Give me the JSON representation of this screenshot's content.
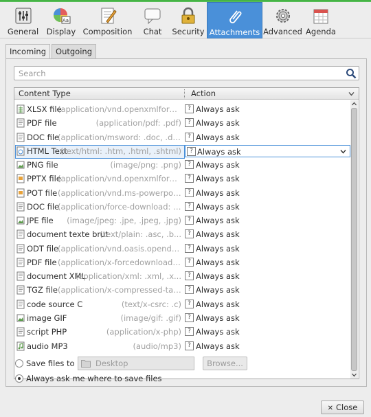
{
  "toolbar": {
    "items": [
      {
        "label": "General",
        "icon": "general-sliders-icon",
        "active": false
      },
      {
        "label": "Display",
        "icon": "display-palette-icon",
        "active": false
      },
      {
        "label": "Composition",
        "icon": "composition-pencil-icon",
        "active": false
      },
      {
        "label": "Chat",
        "icon": "chat-bubble-icon",
        "active": false
      },
      {
        "label": "Security",
        "icon": "security-lock-icon",
        "active": false
      },
      {
        "label": "Attachments",
        "icon": "attachments-paperclip-icon",
        "active": true
      },
      {
        "label": "Advanced",
        "icon": "advanced-gear-icon",
        "active": false
      },
      {
        "label": "Agenda",
        "icon": "agenda-calendar-icon",
        "active": false
      }
    ],
    "accent_color": "#4a90d9"
  },
  "tabs": [
    {
      "label": "Incoming",
      "active": true
    },
    {
      "label": "Outgoing",
      "active": false
    }
  ],
  "search": {
    "placeholder": "Search"
  },
  "table": {
    "columns": [
      "Content Type",
      "Action"
    ],
    "rows": [
      {
        "name": "XLSX file",
        "mime": "(application/vnd.openxmlforma...",
        "action": "Always ask",
        "icon": "spreadsheet-file-icon"
      },
      {
        "name": "PDF file",
        "mime": "(application/pdf: .pdf)",
        "action": "Always ask",
        "icon": "document-file-icon"
      },
      {
        "name": "DOC file",
        "mime": "(application/msword: .doc, .dot)",
        "action": "Always ask",
        "icon": "document-file-icon"
      },
      {
        "name": "HTML Text",
        "mime": "(text/html: .htm, .html, .shtml)",
        "action": "Always ask",
        "icon": "html-file-icon",
        "selected": true
      },
      {
        "name": "PNG file",
        "mime": "(image/png: .png)",
        "action": "Always ask",
        "icon": "image-file-icon"
      },
      {
        "name": "PPTX file",
        "mime": "(application/vnd.openxmlforma...",
        "action": "Always ask",
        "icon": "presentation-file-icon"
      },
      {
        "name": "POT file",
        "mime": "(application/vnd.ms-powerpoint:...",
        "action": "Always ask",
        "icon": "presentation-file-icon"
      },
      {
        "name": "DOC file",
        "mime": "(application/force-download: .do...",
        "action": "Always ask",
        "icon": "document-file-icon"
      },
      {
        "name": "JPE file",
        "mime": "(image/jpeg: .jpe, .jpeg, .jpg)",
        "action": "Always ask",
        "icon": "image-file-icon"
      },
      {
        "name": "document texte brut",
        "mime": "(text/plain: .asc, .b...",
        "action": "Always ask",
        "icon": "document-file-icon"
      },
      {
        "name": "ODT file",
        "mime": "(application/vnd.oasis.opendocu...",
        "action": "Always ask",
        "icon": "document-file-icon"
      },
      {
        "name": "PDF file",
        "mime": "(application/x-forcedownload: .pdf)",
        "action": "Always ask",
        "icon": "document-file-icon"
      },
      {
        "name": "document XML",
        "mime": "(application/xml: .xml, .x...",
        "action": "Always ask",
        "icon": "document-file-icon"
      },
      {
        "name": "TGZ file",
        "mime": "(application/x-compressed-tar: ...",
        "action": "Always ask",
        "icon": "document-file-icon"
      },
      {
        "name": "code source C",
        "mime": "(text/x-csrc: .c)",
        "action": "Always ask",
        "icon": "document-file-icon"
      },
      {
        "name": "image GIF",
        "mime": "(image/gif: .gif)",
        "action": "Always ask",
        "icon": "image-file-icon"
      },
      {
        "name": "script PHP",
        "mime": "(application/x-php)",
        "action": "Always ask",
        "icon": "document-file-icon"
      },
      {
        "name": "audio MP3",
        "mime": "(audio/mp3)",
        "action": "Always ask",
        "icon": "audio-file-icon"
      }
    ]
  },
  "save": {
    "save_to_label": "Save files to",
    "folder": "Desktop",
    "browse_label": "Browse...",
    "always_ask_label": "Always ask me where to save files",
    "selected": "always_ask"
  },
  "close_label": "Close"
}
